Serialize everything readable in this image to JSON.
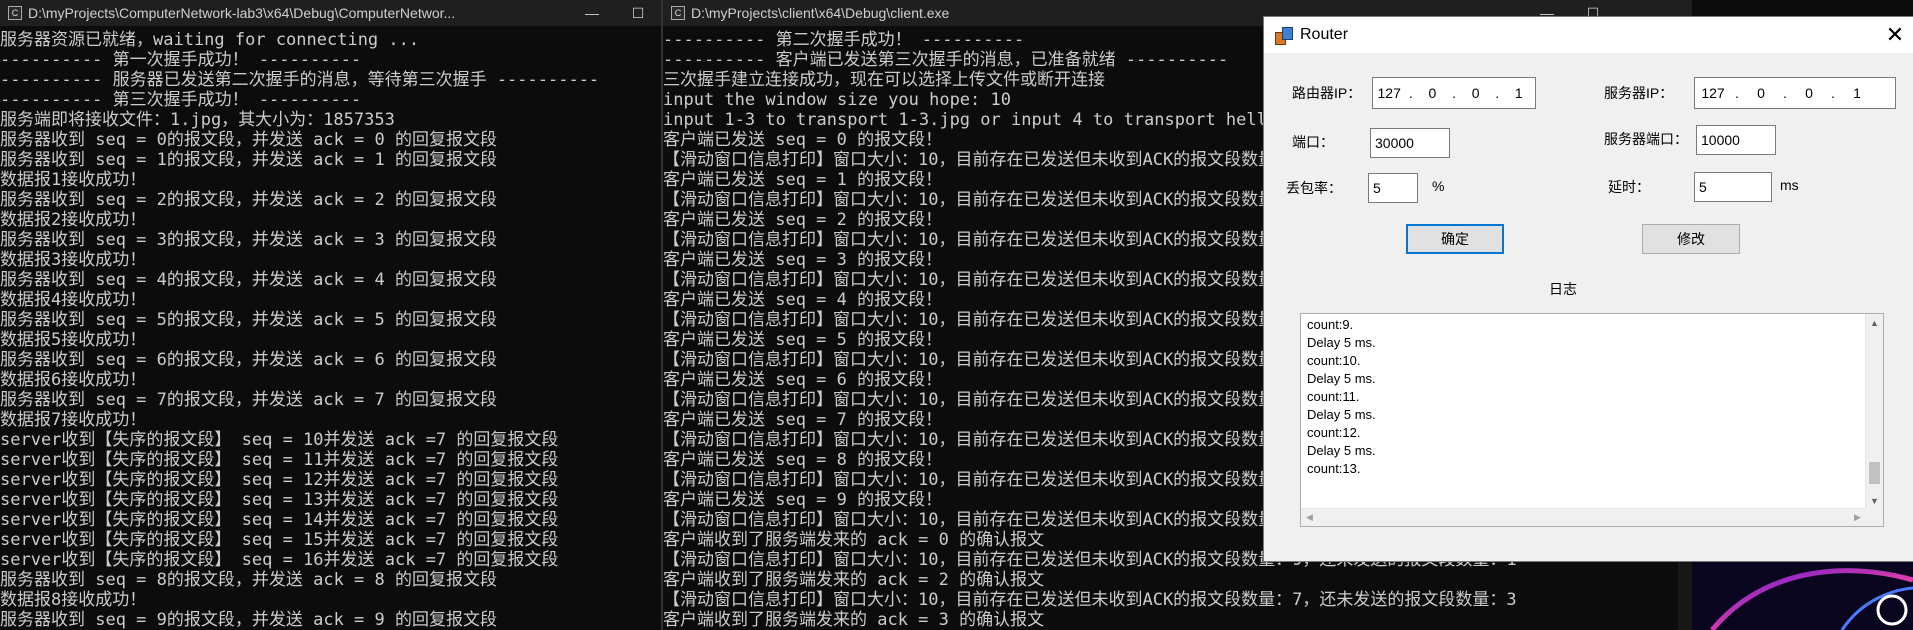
{
  "server_console": {
    "title": "D:\\myProjects\\ComputerNetwork-lab3\\x64\\Debug\\ComputerNetwor...",
    "lines": [
      "服务器资源已就绪，waiting for connecting ...",
      "---------- 第一次握手成功！ ----------",
      "---------- 服务器已发送第二次握手的消息，等待第三次握手 ----------",
      "---------- 第三次握手成功！ ----------",
      "服务端即将接收文件：1.jpg，其大小为：1857353",
      "服务器收到 seq = 0的报文段，并发送 ack = 0 的回复报文段",
      "服务器收到 seq = 1的报文段，并发送 ack = 1 的回复报文段",
      "数据报1接收成功！",
      "服务器收到 seq = 2的报文段，并发送 ack = 2 的回复报文段",
      "数据报2接收成功！",
      "服务器收到 seq = 3的报文段，并发送 ack = 3 的回复报文段",
      "数据报3接收成功！",
      "服务器收到 seq = 4的报文段，并发送 ack = 4 的回复报文段",
      "数据报4接收成功！",
      "服务器收到 seq = 5的报文段，并发送 ack = 5 的回复报文段",
      "数据报5接收成功！",
      "服务器收到 seq = 6的报文段，并发送 ack = 6 的回复报文段",
      "数据报6接收成功！",
      "服务器收到 seq = 7的报文段，并发送 ack = 7 的回复报文段",
      "数据报7接收成功！",
      "server收到【失序的报文段】 seq = 10并发送 ack =7 的回复报文段",
      "server收到【失序的报文段】 seq = 11并发送 ack =7 的回复报文段",
      "server收到【失序的报文段】 seq = 12并发送 ack =7 的回复报文段",
      "server收到【失序的报文段】 seq = 13并发送 ack =7 的回复报文段",
      "server收到【失序的报文段】 seq = 14并发送 ack =7 的回复报文段",
      "server收到【失序的报文段】 seq = 15并发送 ack =7 的回复报文段",
      "server收到【失序的报文段】 seq = 16并发送 ack =7 的回复报文段",
      "服务器收到 seq = 8的报文段，并发送 ack = 8 的回复报文段",
      "数据报8接收成功！",
      "服务器收到 seq = 9的报文段，并发送 ack = 9 的回复报文段"
    ]
  },
  "client_console": {
    "title": "D:\\myProjects\\client\\x64\\Debug\\client.exe",
    "lines": [
      "---------- 第二次握手成功！ ----------",
      "---------- 客户端已发送第三次握手的消息，已准备就绪 ----------",
      "三次握手建立连接成功，现在可以选择上传文件或断开连接",
      "input the window size you hope: 10",
      "input 1-3 to transport 1-3.jpg or input 4 to transport helloworld.txt",
      "客户端已发送 seq = 0 的报文段！",
      "【滑动窗口信息打印】窗口大小：10，目前存在已发送但未收到ACK的报文段数量：1，还未发送的报文段数量：10",
      "客户端已发送 seq = 1 的报文段！",
      "【滑动窗口信息打印】窗口大小：10，目前存在已发送但未收到ACK的报文段数量：2，还未发送的报文段数量：9",
      "客户端已发送 seq = 2 的报文段！",
      "【滑动窗口信息打印】窗口大小：10，目前存在已发送但未收到ACK的报文段数量：3，还未发送的报文段数量：8",
      "客户端已发送 seq = 3 的报文段！",
      "【滑动窗口信息打印】窗口大小：10，目前存在已发送但未收到ACK的报文段数量：4，还未发送的报文段数量：7",
      "客户端已发送 seq = 4 的报文段！",
      "【滑动窗口信息打印】窗口大小：10，目前存在已发送但未收到ACK的报文段数量：5，还未发送的报文段数量：6",
      "客户端已发送 seq = 5 的报文段！",
      "【滑动窗口信息打印】窗口大小：10，目前存在已发送但未收到ACK的报文段数量：6，还未发送的报文段数量：5",
      "客户端已发送 seq = 6 的报文段！",
      "【滑动窗口信息打印】窗口大小：10，目前存在已发送但未收到ACK的报文段数量：7，还未发送的报文段数量：4",
      "客户端已发送 seq = 7 的报文段！",
      "【滑动窗口信息打印】窗口大小：10，目前存在已发送但未收到ACK的报文段数量：8，还未发送的报文段数量：3",
      "客户端已发送 seq = 8 的报文段！",
      "【滑动窗口信息打印】窗口大小：10，目前存在已发送但未收到ACK的报文段数量：9，还未发送的报文段数量：2",
      "客户端已发送 seq = 9 的报文段！",
      "【滑动窗口信息打印】窗口大小：10，目前存在已发送但未收到ACK的报文段数量：10，还未发送的报文段数量：1",
      "客户端收到了服务端发来的 ack = 0 的确认报文",
      "【滑动窗口信息打印】窗口大小：10，目前存在已发送但未收到ACK的报文段数量：9，还未发送的报文段数量：1",
      "客户端收到了服务端发来的 ack = 2 的确认报文",
      "【滑动窗口信息打印】窗口大小：10，目前存在已发送但未收到ACK的报文段数量：7，还未发送的报文段数量：3",
      "客户端收到了服务端发来的 ack = 3 的确认报文"
    ]
  },
  "router": {
    "title": "Router",
    "router_ip_label": "路由器IP：",
    "router_ip": [
      "127",
      "0",
      "0",
      "1"
    ],
    "server_ip_label": "服务器IP：",
    "server_ip": [
      "127",
      "0",
      "0",
      "1"
    ],
    "port_label": "端口：",
    "port_value": "30000",
    "server_port_label": "服务器端口：",
    "server_port_value": "10000",
    "loss_label": "丢包率：",
    "loss_value": "5",
    "loss_unit": "%",
    "delay_label": "延时：",
    "delay_value": "5",
    "delay_unit": "ms",
    "ok_button": "确定",
    "modify_button": "修改",
    "log_label": "日志",
    "log_lines": [
      "count:9.",
      "Delay 5 ms.",
      "count:10.",
      "Delay 5 ms.",
      "count:11.",
      "Delay 5 ms.",
      "count:12.",
      "Delay 5 ms.",
      "count:13."
    ],
    "close_glyph": "✕"
  },
  "window_controls": {
    "minimize": "—",
    "maximize": "☐",
    "close": "✕"
  }
}
